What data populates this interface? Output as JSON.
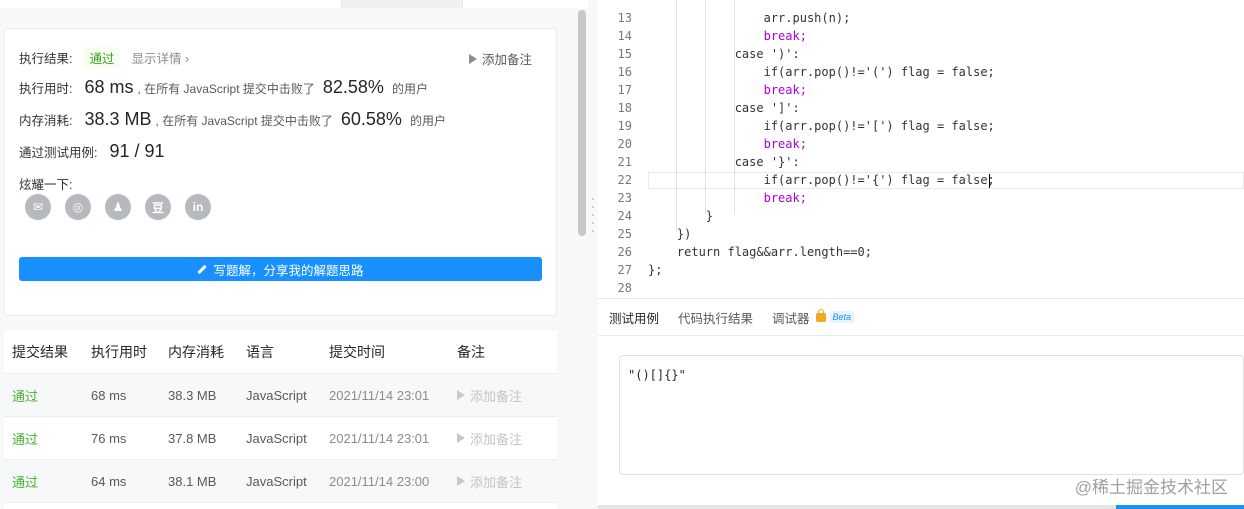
{
  "result": {
    "status_label": "执行结果:",
    "status_value": "通过",
    "details_link": "显示详情 ›",
    "add_note": "添加备注",
    "runtime_label": "执行用时:",
    "runtime_value": "68 ms",
    "runtime_text": ", 在所有 JavaScript 提交中击败了",
    "runtime_pct": "82.58%",
    "runtime_suffix": "的用户",
    "memory_label": "内存消耗:",
    "memory_value": "38.3 MB",
    "memory_text": ", 在所有 JavaScript 提交中击败了",
    "memory_pct": "60.58%",
    "memory_suffix": "的用户",
    "tests_label": "通过测试用例:",
    "tests_value": "91 / 91",
    "share_label": "炫耀一下:",
    "share_buttons": [
      "wechat-icon",
      "weibo-icon",
      "qq-icon",
      "douban-icon",
      "linkedin-icon"
    ],
    "share_glyphs": [
      "✉",
      "◎",
      "♟",
      "豆",
      "in"
    ],
    "write_button": "写题解，分享我的解题思路"
  },
  "submissions": {
    "headers": [
      "提交结果",
      "执行用时",
      "内存消耗",
      "语言",
      "提交时间",
      "备注"
    ],
    "rows": [
      {
        "status": "通过",
        "runtime": "68 ms",
        "memory": "38.3 MB",
        "lang": "JavaScript",
        "time": "2021/11/14 23:01",
        "note": "添加备注"
      },
      {
        "status": "通过",
        "runtime": "76 ms",
        "memory": "37.8 MB",
        "lang": "JavaScript",
        "time": "2021/11/14 23:01",
        "note": "添加备注"
      },
      {
        "status": "通过",
        "runtime": "64 ms",
        "memory": "38.1 MB",
        "lang": "JavaScript",
        "time": "2021/11/14 23:00",
        "note": "添加备注"
      }
    ]
  },
  "editor": {
    "line_numbers": [
      "13",
      "14",
      "15",
      "16",
      "17",
      "18",
      "19",
      "20",
      "21",
      "22",
      "23",
      "24",
      "25",
      "26",
      "27",
      "28"
    ],
    "lines": [
      "                arr.push(n);",
      "                break;",
      "            case ')':",
      "                if(arr.pop()!='(') flag = false;",
      "                break;",
      "            case ']':",
      "                if(arr.pop()!='[') flag = false;",
      "                break;",
      "            case '}':",
      "                if(arr.pop()!='{') flag = false;",
      "                break;",
      "        }",
      "    })",
      "    return flag&&arr.length==0;",
      "};",
      ""
    ]
  },
  "console": {
    "tabs": [
      "测试用例",
      "代码执行结果",
      "调试器"
    ],
    "beta": "Beta",
    "testcase": "\"()[]{}\""
  },
  "watermark": "@稀土掘金技术社区",
  "colors": {
    "accent": "#1890ff",
    "pass": "#45b32d",
    "keyword": "#af00db",
    "string": "#a31515"
  }
}
